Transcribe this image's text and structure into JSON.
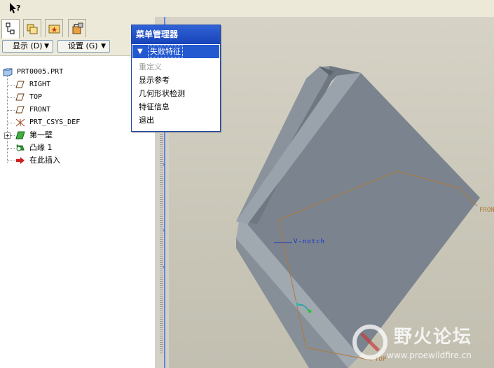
{
  "toolbar": {
    "whats_this_icon": "whats-this-pointer-icon"
  },
  "tabs": [
    {
      "name": "model-tree",
      "icon": "model-tree-icon",
      "active": true
    },
    {
      "name": "folder-browser",
      "icon": "folder-icon",
      "active": false
    },
    {
      "name": "favorites",
      "icon": "favorites-icon",
      "active": false
    },
    {
      "name": "connections",
      "icon": "connections-icon",
      "active": false
    }
  ],
  "buttons": {
    "show": "显示 (D)",
    "settings": "设置 (G)"
  },
  "tree": {
    "root": "PRT0005.PRT",
    "items": [
      {
        "label": "RIGHT",
        "icon": "datum-plane-icon"
      },
      {
        "label": "TOP",
        "icon": "datum-plane-icon"
      },
      {
        "label": "FRONT",
        "icon": "datum-plane-icon"
      },
      {
        "label": "PRT_CSYS_DEF",
        "icon": "coordinate-system-icon"
      },
      {
        "label": "第一壁",
        "icon": "sheetmetal-wall-icon"
      },
      {
        "label": "凸缘 1",
        "icon": "flange-failed-icon"
      },
      {
        "label": "在此插入",
        "icon": "insert-here-arrow-icon"
      }
    ]
  },
  "menu_manager": {
    "title": "菜单管理器",
    "header": "失败特征",
    "items": [
      {
        "label": "重定义",
        "enabled": false
      },
      {
        "label": "显示参考",
        "enabled": true
      },
      {
        "label": "几何形状检测",
        "enabled": true
      },
      {
        "label": "特征信息",
        "enabled": true
      },
      {
        "label": "退出",
        "enabled": true
      }
    ]
  },
  "viewport": {
    "labels": {
      "vnotch": "V-notch",
      "front": "FRONT",
      "top": "TOP"
    },
    "colors": {
      "model": "#7f8892",
      "model_light": "#9aa2ab",
      "datum": "#b07a3a",
      "background": "#d0cdbf"
    }
  },
  "watermark": {
    "title": "野火论坛",
    "url": "www.proewildfire.cn"
  }
}
